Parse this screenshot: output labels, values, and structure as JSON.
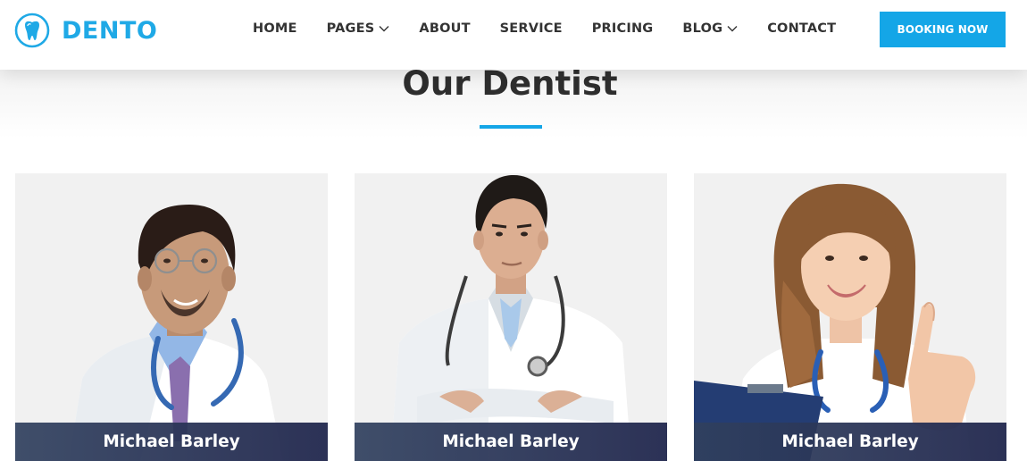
{
  "brand": {
    "name": "DENTO",
    "icon": "tooth-logo-icon",
    "color": "#1fa9e6"
  },
  "nav": {
    "items": [
      {
        "label": "HOME",
        "dropdown": false
      },
      {
        "label": "PAGES",
        "dropdown": true
      },
      {
        "label": "ABOUT",
        "dropdown": false
      },
      {
        "label": "SERVICE",
        "dropdown": false
      },
      {
        "label": "PRICING",
        "dropdown": false
      },
      {
        "label": "BLOG",
        "dropdown": true
      },
      {
        "label": "CONTACT",
        "dropdown": false
      }
    ]
  },
  "booking": {
    "label": "BOOKING NOW",
    "color": "#14a6e7"
  },
  "section": {
    "title": "Our Dentist",
    "accent": "#14a6e7"
  },
  "dentists": [
    {
      "name": "Michael Barley",
      "photo": "dentist-photo-male-glasses"
    },
    {
      "name": "Michael Barley",
      "photo": "dentist-photo-male-arms-crossed"
    },
    {
      "name": "Michael Barley",
      "photo": "dentist-photo-female-thumbs-up"
    }
  ]
}
